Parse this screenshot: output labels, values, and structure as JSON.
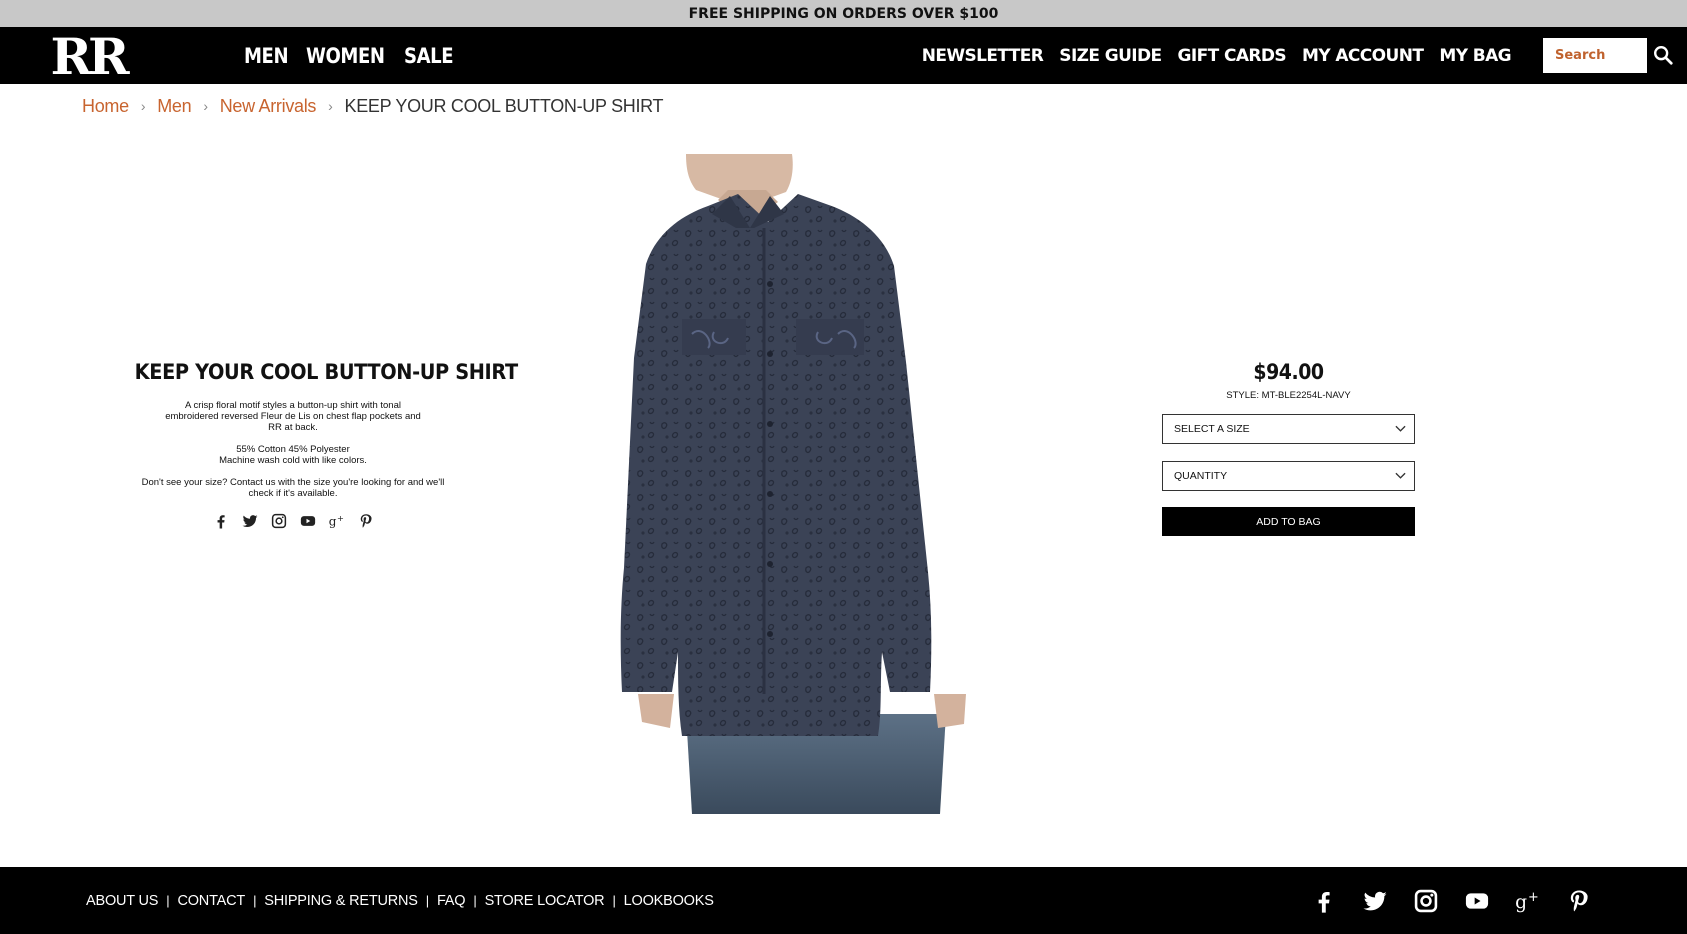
{
  "promo": {
    "text": "FREE SHIPPING ON ORDERS OVER $100"
  },
  "header": {
    "logo_text": "RR",
    "nav_main": [
      "MEN",
      "WOMEN",
      "SALE"
    ],
    "nav_util": [
      "NEWSLETTER",
      "SIZE GUIDE",
      "GIFT CARDS",
      "MY ACCOUNT",
      "MY BAG"
    ],
    "search_placeholder": "Search"
  },
  "breadcrumb": {
    "items": [
      "Home",
      "Men",
      "New Arrivals"
    ],
    "current": "KEEP YOUR COOL BUTTON-UP SHIRT"
  },
  "product": {
    "title": "KEEP YOUR COOL BUTTON-UP SHIRT",
    "description": "A crisp floral motif styles a button-up shirt with tonal embroidered reversed Fleur de Lis on chest flap pockets and RR at back.",
    "composition": "55% Cotton 45% Polyester",
    "care": "Machine wash cold with like colors.",
    "size_note": "Don't see your size? Contact us with the size you're looking for and we'll check if it's available.",
    "share_icons": [
      "facebook-icon",
      "twitter-icon",
      "instagram-icon",
      "youtube-icon",
      "google-plus-icon",
      "pinterest-icon"
    ],
    "shirt_color": "#3a4254"
  },
  "buy": {
    "price": "$94.00",
    "style": "STYLE: MT-BLE2254L-NAVY",
    "size_select": "SELECT A SIZE",
    "quantity_select": "QUANTITY",
    "add_to_bag": "ADD TO BAG"
  },
  "footer": {
    "links": [
      "ABOUT US",
      "CONTACT",
      "SHIPPING & RETURNS",
      "FAQ",
      "STORE LOCATOR",
      "LOOKBOOKS"
    ],
    "social_icons": [
      "facebook-icon",
      "twitter-icon",
      "instagram-icon",
      "youtube-icon",
      "google-plus-icon",
      "pinterest-icon"
    ]
  },
  "colors": {
    "accent": "#c8642f",
    "header_bg": "#000000",
    "promo_bg": "#c8c8c8"
  }
}
